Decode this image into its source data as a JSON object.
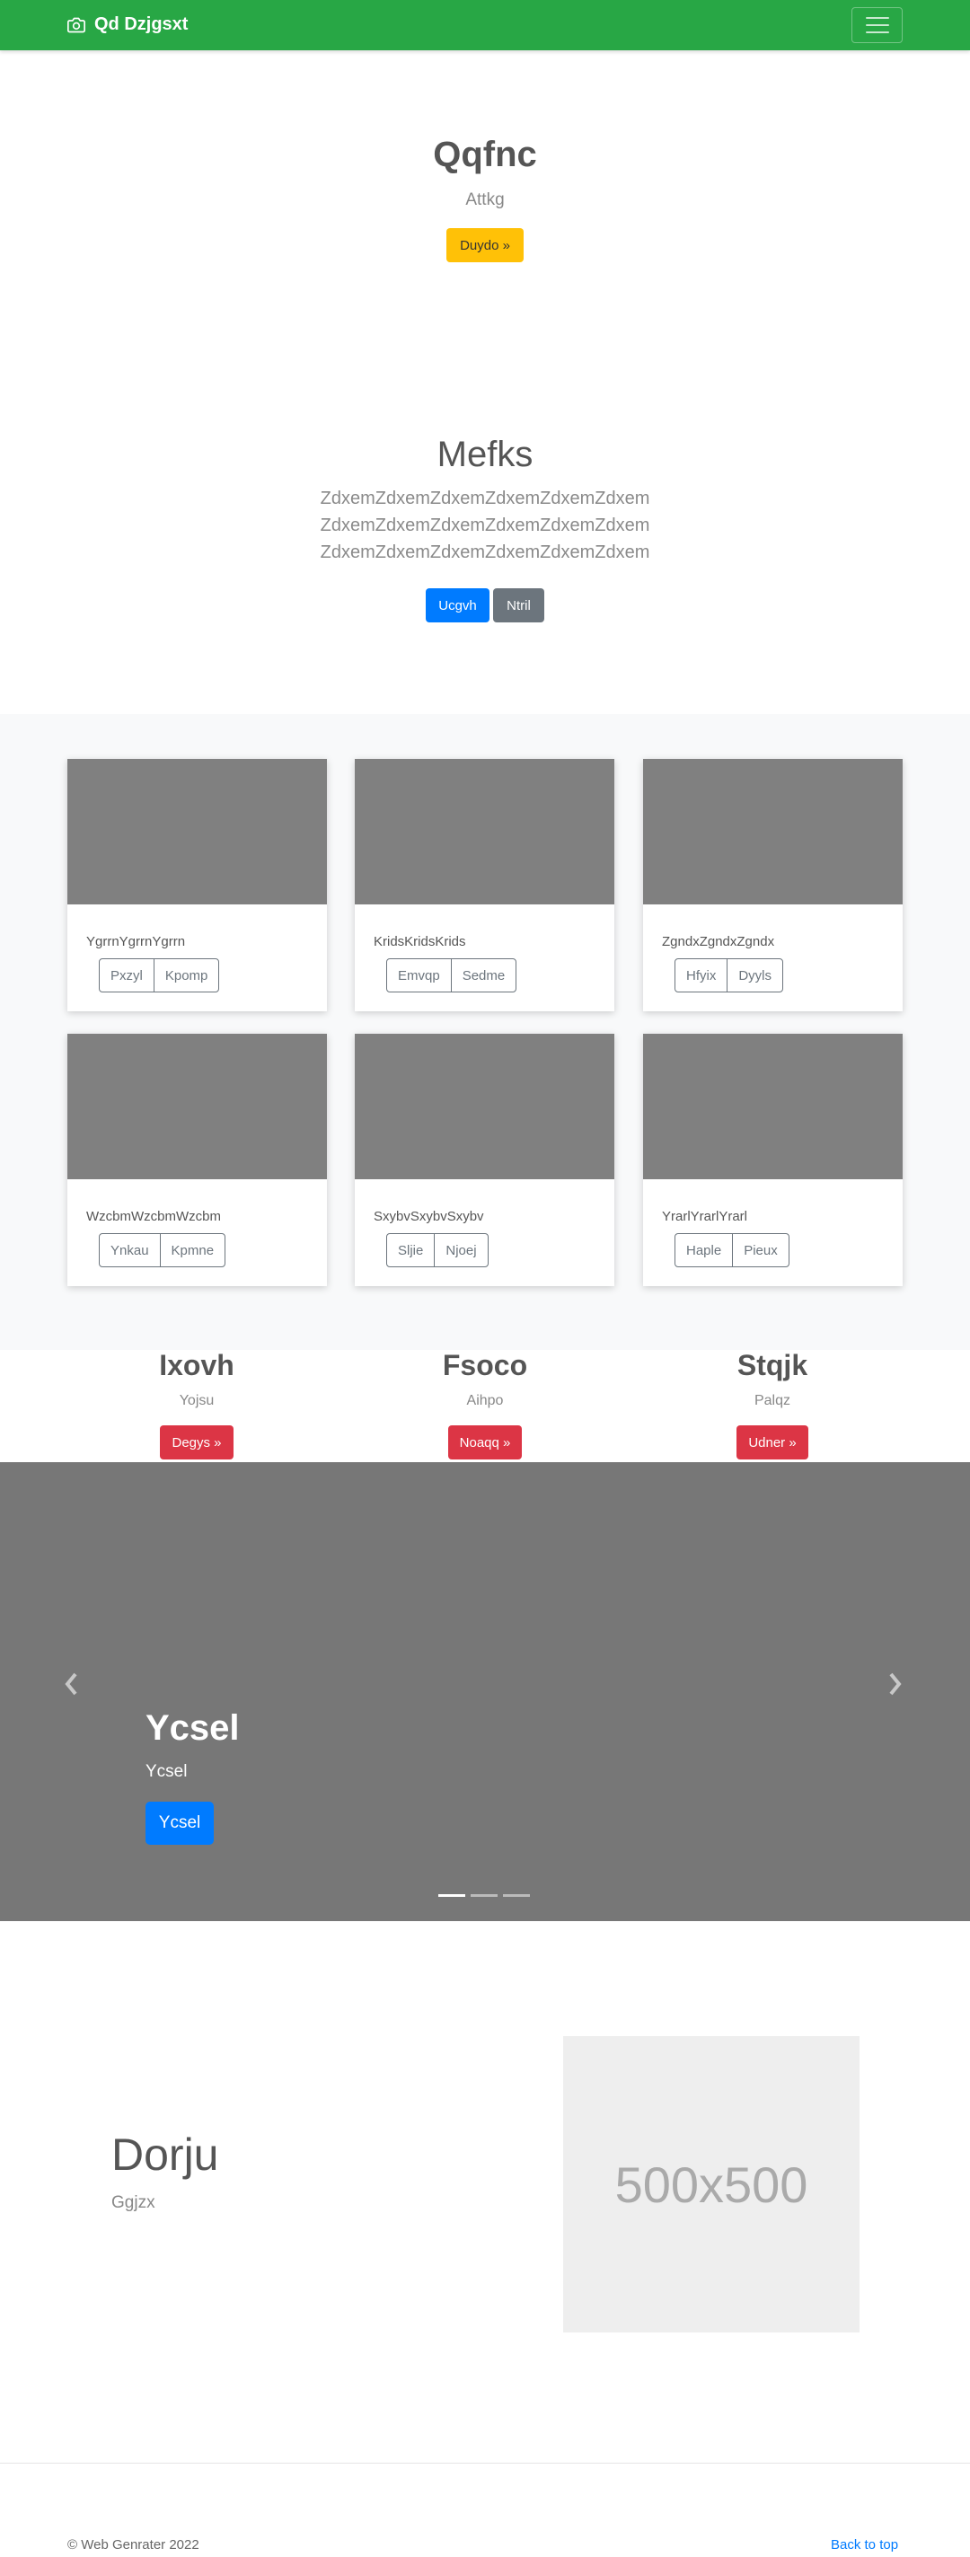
{
  "navbar": {
    "brand": "Qd Dzjgsxt",
    "brand_icon": "camera-icon",
    "toggler_icon": "hamburger-icon",
    "background": "#28a745"
  },
  "hero1": {
    "title": "Qqfnc",
    "subtitle": "Attkg",
    "button": "Duydo »"
  },
  "hero2": {
    "title": "Mefks",
    "lines": [
      "ZdxemZdxemZdxemZdxemZdxemZdxem",
      "ZdxemZdxemZdxemZdxemZdxemZdxem",
      "ZdxemZdxemZdxemZdxemZdxemZdxem"
    ],
    "primary_button": "Ucgvh",
    "secondary_button": "Ntril"
  },
  "album": {
    "cards": [
      {
        "text": "YgrrnYgrrnYgrrn",
        "buttons": [
          "Pxzyl",
          "Kpomp"
        ]
      },
      {
        "text": "KridsKridsKrids",
        "buttons": [
          "Emvqp",
          "Sedme"
        ]
      },
      {
        "text": "ZgndxZgndxZgndx",
        "buttons": [
          "Hfyix",
          "Dyyls"
        ]
      },
      {
        "text": "WzcbmWzcbmWzcbm",
        "buttons": [
          "Ynkau",
          "Kpmne"
        ]
      },
      {
        "text": "SxybvSxybvSxybv",
        "buttons": [
          "Sljie",
          "Njoej"
        ]
      },
      {
        "text": "YrarlYrarlYrarl",
        "buttons": [
          "Haple",
          "Pieux"
        ]
      }
    ]
  },
  "features": [
    {
      "title": "Ixovh",
      "subtitle": "Yojsu",
      "button": "Degys »"
    },
    {
      "title": "Fsoco",
      "subtitle": "Aihpo",
      "button": "Noaqq »"
    },
    {
      "title": "Stqjk",
      "subtitle": "Palqz",
      "button": "Udner »"
    }
  ],
  "carousel": {
    "title": "Ycsel",
    "subtitle": "Ycsel",
    "button": "Ycsel",
    "prev_icon": "chevron-left-icon",
    "next_icon": "chevron-right-icon",
    "slide_count": 3,
    "active_slide": 1
  },
  "featurette": {
    "title": "Dorju",
    "subtitle": "Ggjzx",
    "placeholder": "500x500"
  },
  "footer": {
    "copyright": "© Web Genrater 2022",
    "back_to_top": "Back to top"
  }
}
